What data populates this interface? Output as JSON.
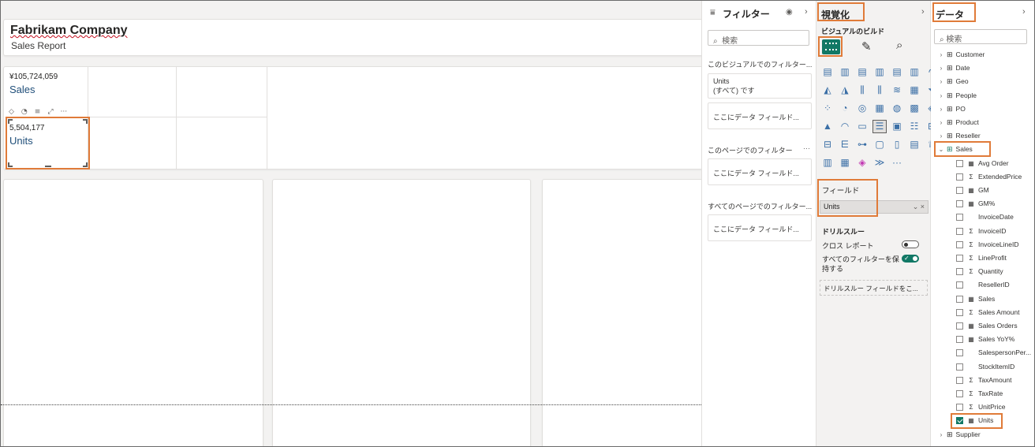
{
  "report": {
    "company": "Fabrikam Company",
    "subtitle": "Sales Report",
    "kpis": [
      {
        "value": "¥105,724,059",
        "label": "Sales"
      },
      {
        "value": "5,504,177",
        "label": "Units"
      }
    ]
  },
  "filters": {
    "title": "フィルター",
    "search_placeholder": "検索",
    "visual_section": "このビジュアルでのフィルター...",
    "visual_card_field": "Units",
    "visual_card_state": "(すべて) です",
    "drop_placeholder": "ここにデータ フィールド...",
    "page_section": "このページでのフィルター",
    "all_pages_section": "すべてのページでのフィルター..."
  },
  "visualizations": {
    "title": "視覚化",
    "build_label": "ビジュアルのビルド",
    "fields_section": "フィールド",
    "field_value": "Units",
    "drillthrough_title": "ドリルスルー",
    "cross_report": "クロス レポート",
    "keep_filters_line1": "すべてのフィルターを保",
    "keep_filters_line2": "持する",
    "drill_placeholder": "ドリルスルー フィールドをこ..."
  },
  "data_pane": {
    "title": "データ",
    "search_placeholder": "検索",
    "tables_before": [
      "Customer",
      "Date",
      "Geo",
      "People",
      "PO",
      "Product",
      "Reseller"
    ],
    "expanded_table": "Sales",
    "fields": [
      {
        "name": "Avg Order",
        "type": "measure",
        "checked": false
      },
      {
        "name": "ExtendedPrice",
        "type": "sum",
        "checked": false
      },
      {
        "name": "GM",
        "type": "measure",
        "checked": false
      },
      {
        "name": "GM%",
        "type": "measure",
        "checked": false
      },
      {
        "name": "InvoiceDate",
        "type": "none",
        "checked": false
      },
      {
        "name": "InvoiceID",
        "type": "sum",
        "checked": false
      },
      {
        "name": "InvoiceLineID",
        "type": "sum",
        "checked": false
      },
      {
        "name": "LineProfit",
        "type": "sum",
        "checked": false
      },
      {
        "name": "Quantity",
        "type": "sum",
        "checked": false
      },
      {
        "name": "ResellerID",
        "type": "none",
        "checked": false
      },
      {
        "name": "Sales",
        "type": "measure",
        "checked": false
      },
      {
        "name": "Sales Amount",
        "type": "sum",
        "checked": false
      },
      {
        "name": "Sales Orders",
        "type": "measure",
        "checked": false
      },
      {
        "name": "Sales YoY%",
        "type": "measure",
        "checked": false
      },
      {
        "name": "SalespersonPer...",
        "type": "none",
        "checked": false
      },
      {
        "name": "StockItemID",
        "type": "none",
        "checked": false
      },
      {
        "name": "TaxAmount",
        "type": "sum",
        "checked": false
      },
      {
        "name": "TaxRate",
        "type": "sum",
        "checked": false
      },
      {
        "name": "UnitPrice",
        "type": "sum",
        "checked": false
      },
      {
        "name": "Units",
        "type": "measure",
        "checked": true
      }
    ],
    "tables_after": [
      "Supplier"
    ]
  },
  "colors": {
    "highlight": "#e07b39",
    "accent": "#117865",
    "kpi_label": "#1f4e79"
  }
}
